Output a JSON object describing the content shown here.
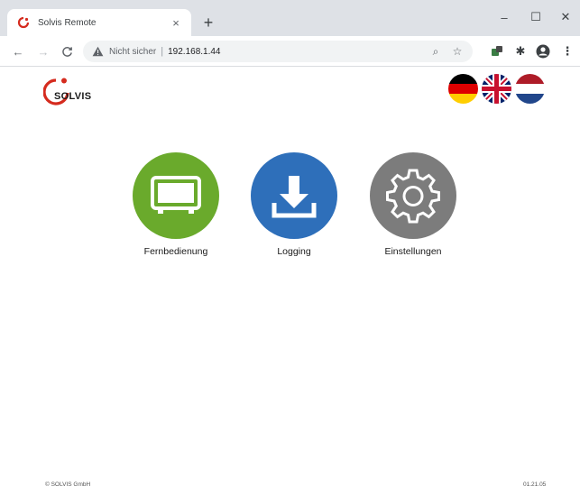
{
  "browser": {
    "tab_title": "Solvis Remote",
    "tab_close": "×",
    "new_tab": "+",
    "window_controls": {
      "minimize": "–",
      "maximize": "☐",
      "close": "✕"
    },
    "nav": {
      "back": "←",
      "forward": "→",
      "reload": "C"
    },
    "address_bar": {
      "security_label": "Nicht sicher",
      "separator": "|",
      "url": "192.168.1.44"
    },
    "toolbar_icons": [
      "search-icon",
      "star-icon",
      "extension-icon",
      "puzzle-icon",
      "profile-icon",
      "menu-icon"
    ],
    "toolbar_glyphs": {
      "search": "⌕",
      "star": "☆",
      "puzzle": "✱",
      "menu": "⋮"
    }
  },
  "page": {
    "logo_text": "SOLVIS",
    "languages": [
      "de",
      "en",
      "nl"
    ],
    "tiles": [
      {
        "label": "Fernbedienung",
        "icon": "remote-screen-icon",
        "color": "#6aaa2c"
      },
      {
        "label": "Logging",
        "icon": "download-icon",
        "color": "#2e6fba"
      },
      {
        "label": "Einstellungen",
        "icon": "gear-icon",
        "color": "#7c7c7c"
      }
    ],
    "footer_left": "© SOLVIS GmbH",
    "footer_right": "01.21.05"
  },
  "colors": {
    "brand_red": "#d52b1e",
    "fernbedienung_green": "#6aaa2c",
    "logging_blue": "#2e6fba",
    "settings_gray": "#7c7c7c",
    "chrome_bg": "#dee1e6"
  }
}
